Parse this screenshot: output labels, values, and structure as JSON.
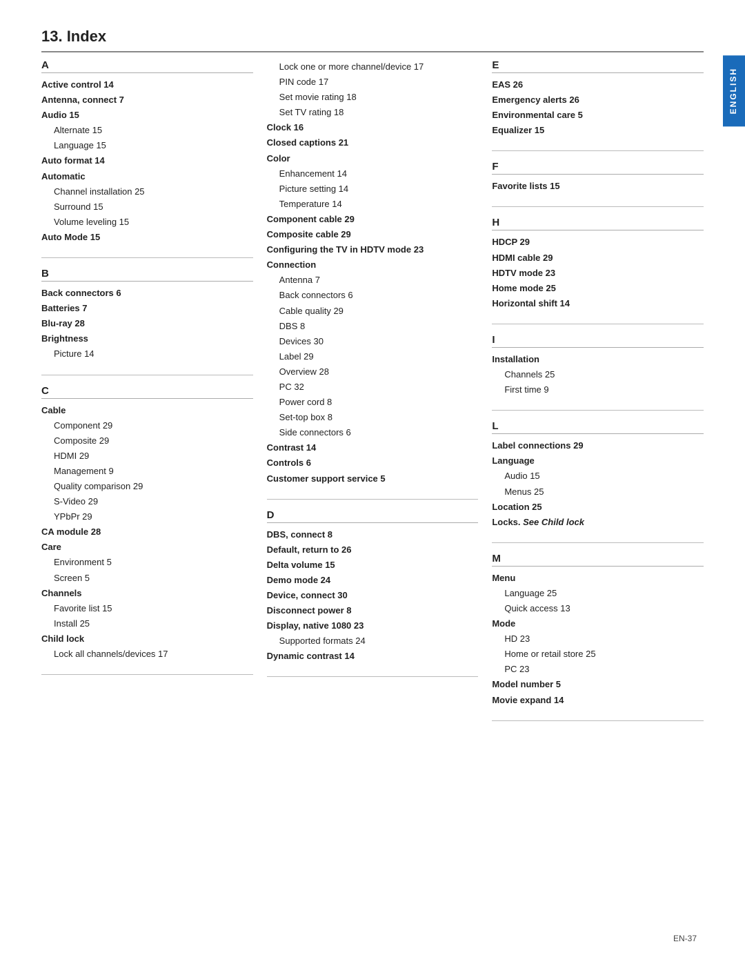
{
  "page": {
    "title": "13.  Index",
    "english_tab": "ENGLISH",
    "page_number": "EN-37"
  },
  "col1": {
    "sections": [
      {
        "letter": "A",
        "entries": [
          {
            "text": "Active control  14",
            "style": "bold"
          },
          {
            "text": "Antenna, connect  7",
            "style": "bold"
          },
          {
            "text": "Audio  15",
            "style": "bold"
          },
          {
            "text": "Alternate  15",
            "style": "indent1"
          },
          {
            "text": "Language  15",
            "style": "indent1"
          },
          {
            "text": "Auto format  14",
            "style": "bold"
          },
          {
            "text": "Automatic",
            "style": "bold"
          },
          {
            "text": "Channel installation  25",
            "style": "indent1"
          },
          {
            "text": "Surround  15",
            "style": "indent1"
          },
          {
            "text": "Volume leveling  15",
            "style": "indent1"
          },
          {
            "text": "Auto Mode  15",
            "style": "bold"
          }
        ]
      },
      {
        "letter": "B",
        "entries": [
          {
            "text": "Back connectors  6",
            "style": "bold"
          },
          {
            "text": "Batteries  7",
            "style": "bold"
          },
          {
            "text": "Blu-ray  28",
            "style": "bold"
          },
          {
            "text": "Brightness",
            "style": "bold"
          },
          {
            "text": "Picture  14",
            "style": "indent1"
          }
        ]
      },
      {
        "letter": "C",
        "entries": [
          {
            "text": "Cable",
            "style": "bold"
          },
          {
            "text": "Component  29",
            "style": "indent1"
          },
          {
            "text": "Composite  29",
            "style": "indent1"
          },
          {
            "text": "HDMI  29",
            "style": "indent1"
          },
          {
            "text": "Management  9",
            "style": "indent1"
          },
          {
            "text": "Quality comparison  29",
            "style": "indent1"
          },
          {
            "text": "S-Video  29",
            "style": "indent1"
          },
          {
            "text": "YPbPr  29",
            "style": "indent1"
          },
          {
            "text": "CA module  28",
            "style": "bold"
          },
          {
            "text": "Care",
            "style": "bold"
          },
          {
            "text": "Environment  5",
            "style": "indent1"
          },
          {
            "text": "Screen  5",
            "style": "indent1"
          },
          {
            "text": "Channels",
            "style": "bold"
          },
          {
            "text": "Favorite list  15",
            "style": "indent1"
          },
          {
            "text": "Install  25",
            "style": "indent1"
          },
          {
            "text": "Child lock",
            "style": "bold"
          },
          {
            "text": "Lock all channels/devices  17",
            "style": "indent1"
          }
        ]
      }
    ]
  },
  "col2": {
    "sections": [
      {
        "letter": "",
        "entries": [
          {
            "text": "Lock one or more channel/device  17",
            "style": "indent1"
          },
          {
            "text": "PIN code  17",
            "style": "indent1"
          },
          {
            "text": "Set movie rating  18",
            "style": "indent1"
          },
          {
            "text": "Set TV rating  18",
            "style": "indent1"
          },
          {
            "text": "Clock  16",
            "style": "bold"
          },
          {
            "text": "Closed captions  21",
            "style": "bold"
          },
          {
            "text": "Color",
            "style": "bold"
          },
          {
            "text": "Enhancement  14",
            "style": "indent1"
          },
          {
            "text": "Picture setting  14",
            "style": "indent1"
          },
          {
            "text": "Temperature  14",
            "style": "indent1"
          },
          {
            "text": "Component cable  29",
            "style": "bold"
          },
          {
            "text": "Composite cable  29",
            "style": "bold"
          },
          {
            "text": "Configuring the TV in HDTV mode  23",
            "style": "bold"
          },
          {
            "text": "Connection",
            "style": "bold"
          },
          {
            "text": "Antenna  7",
            "style": "indent1"
          },
          {
            "text": "Back connectors  6",
            "style": "indent1"
          },
          {
            "text": "Cable quality  29",
            "style": "indent1"
          },
          {
            "text": "DBS  8",
            "style": "indent1"
          },
          {
            "text": "Devices  30",
            "style": "indent1"
          },
          {
            "text": "Label  29",
            "style": "indent1"
          },
          {
            "text": "Overview  28",
            "style": "indent1"
          },
          {
            "text": "PC  32",
            "style": "indent1"
          },
          {
            "text": "Power cord  8",
            "style": "indent1"
          },
          {
            "text": "Set-top box  8",
            "style": "indent1"
          },
          {
            "text": "Side connectors  6",
            "style": "indent1"
          },
          {
            "text": "Contrast  14",
            "style": "bold"
          },
          {
            "text": "Controls  6",
            "style": "bold"
          },
          {
            "text": "Customer support service  5",
            "style": "bold"
          }
        ]
      },
      {
        "letter": "D",
        "entries": [
          {
            "text": "DBS, connect  8",
            "style": "bold"
          },
          {
            "text": "Default, return to  26",
            "style": "bold"
          },
          {
            "text": "Delta volume  15",
            "style": "bold"
          },
          {
            "text": "Demo mode  24",
            "style": "bold"
          },
          {
            "text": "Device, connect  30",
            "style": "bold"
          },
          {
            "text": "Disconnect power  8",
            "style": "bold"
          },
          {
            "text": "Display, native 1080  23",
            "style": "bold"
          },
          {
            "text": "Supported formats  24",
            "style": "indent1"
          },
          {
            "text": "Dynamic contrast  14",
            "style": "bold"
          }
        ]
      }
    ]
  },
  "col3": {
    "sections": [
      {
        "letter": "E",
        "entries": [
          {
            "text": "EAS  26",
            "style": "bold"
          },
          {
            "text": "Emergency alerts  26",
            "style": "bold"
          },
          {
            "text": "Environmental care  5",
            "style": "bold"
          },
          {
            "text": "Equalizer  15",
            "style": "bold"
          }
        ]
      },
      {
        "letter": "F",
        "entries": [
          {
            "text": "Favorite lists  15",
            "style": "bold"
          }
        ]
      },
      {
        "letter": "H",
        "entries": [
          {
            "text": "HDCP  29",
            "style": "bold"
          },
          {
            "text": "HDMI cable  29",
            "style": "bold"
          },
          {
            "text": "HDTV mode  23",
            "style": "bold"
          },
          {
            "text": "Home mode  25",
            "style": "bold"
          },
          {
            "text": "Horizontal shift  14",
            "style": "bold"
          }
        ]
      },
      {
        "letter": "I",
        "entries": [
          {
            "text": "Installation",
            "style": "bold"
          },
          {
            "text": "Channels  25",
            "style": "indent1"
          },
          {
            "text": "First time  9",
            "style": "indent1"
          }
        ]
      },
      {
        "letter": "L",
        "entries": [
          {
            "text": "Label connections  29",
            "style": "bold"
          },
          {
            "text": "Language",
            "style": "bold"
          },
          {
            "text": "Audio  15",
            "style": "indent1"
          },
          {
            "text": "Menus  25",
            "style": "indent1"
          },
          {
            "text": "Location  25",
            "style": "bold"
          },
          {
            "text": "Locks. See Child lock",
            "style": "bold italic"
          }
        ]
      },
      {
        "letter": "M",
        "entries": [
          {
            "text": "Menu",
            "style": "bold"
          },
          {
            "text": "Language  25",
            "style": "indent1"
          },
          {
            "text": "Quick access  13",
            "style": "indent1"
          },
          {
            "text": "Mode",
            "style": "bold"
          },
          {
            "text": "HD  23",
            "style": "indent1"
          },
          {
            "text": "Home or retail store  25",
            "style": "indent1"
          },
          {
            "text": "PC  23",
            "style": "indent1"
          },
          {
            "text": "Model number  5",
            "style": "bold"
          },
          {
            "text": "Movie expand  14",
            "style": "bold"
          }
        ]
      }
    ]
  }
}
